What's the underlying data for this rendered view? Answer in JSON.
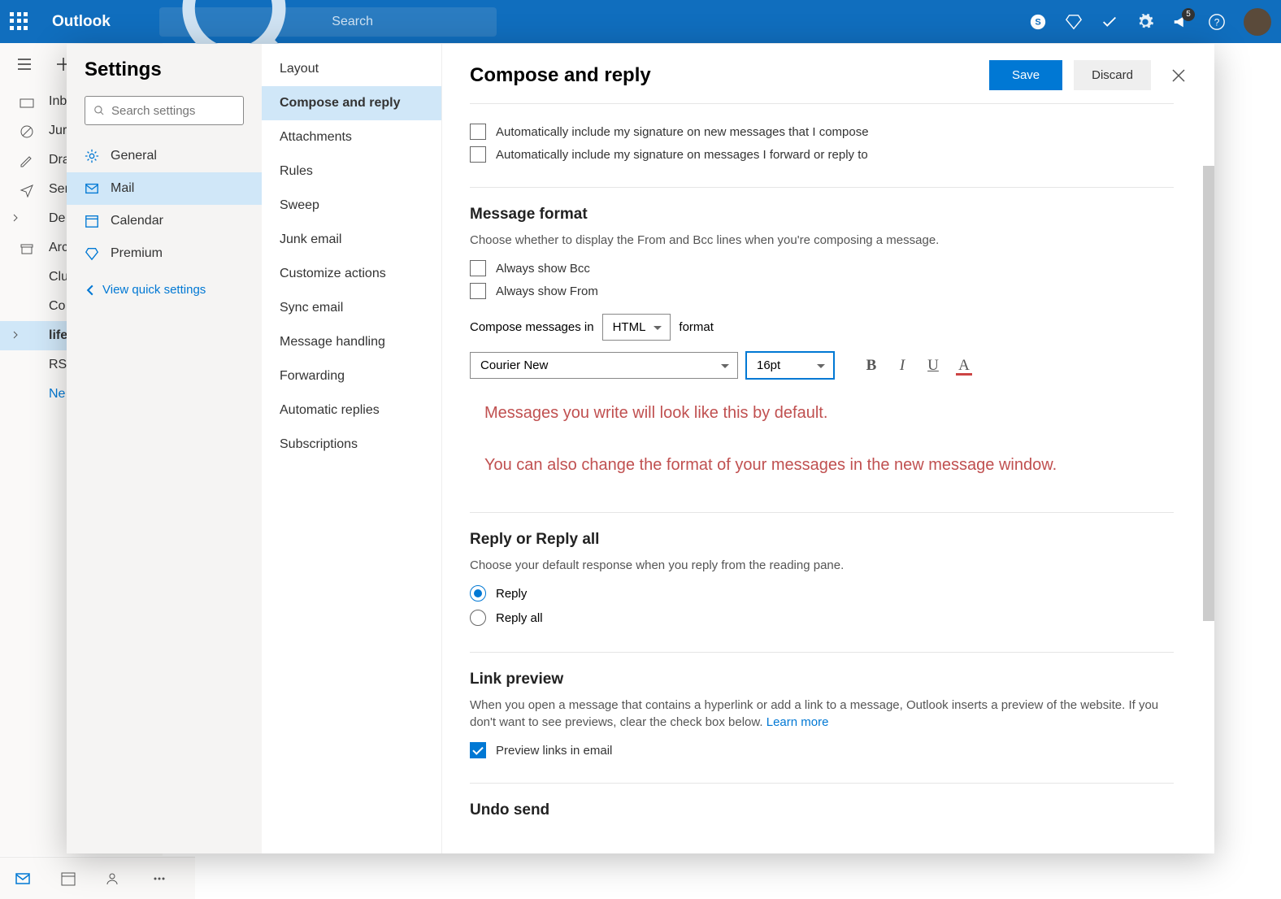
{
  "header": {
    "brand": "Outlook",
    "search_placeholder": "Search",
    "notification_count": "5"
  },
  "folders": [
    {
      "label": "Inb"
    },
    {
      "label": "Jur"
    },
    {
      "label": "Dra"
    },
    {
      "label": "Ser"
    },
    {
      "label": "De"
    },
    {
      "label": "Arc"
    },
    {
      "label": "Clu"
    },
    {
      "label": "Co"
    },
    {
      "label": "life",
      "active": true
    },
    {
      "label": "RSS"
    },
    {
      "label": "Ne",
      "new": true
    }
  ],
  "settings": {
    "title": "Settings",
    "search_placeholder": "Search settings",
    "categories": [
      {
        "label": "General",
        "key": "general"
      },
      {
        "label": "Mail",
        "key": "mail",
        "active": true
      },
      {
        "label": "Calendar",
        "key": "calendar"
      },
      {
        "label": "Premium",
        "key": "premium"
      }
    ],
    "quick_link": "View quick settings",
    "subitems": [
      "Layout",
      "Compose and reply",
      "Attachments",
      "Rules",
      "Sweep",
      "Junk email",
      "Customize actions",
      "Sync email",
      "Message handling",
      "Forwarding",
      "Automatic replies",
      "Subscriptions"
    ],
    "active_sub": "Compose and reply",
    "panel": {
      "title": "Compose and reply",
      "save": "Save",
      "discard": "Discard",
      "sig_new": "Automatically include my signature on new messages that I compose",
      "sig_fwd": "Automatically include my signature on messages I forward or reply to",
      "msgformat_title": "Message format",
      "msgformat_desc": "Choose whether to display the From and Bcc lines when you're composing a message.",
      "show_bcc": "Always show Bcc",
      "show_from": "Always show From",
      "compose_in_pre": "Compose messages in",
      "compose_format": "HTML",
      "compose_in_post": "format",
      "font_family": "Courier New",
      "font_size": "16pt",
      "preview_line1": "Messages you write will look like this by default.",
      "preview_line2": "You can also change the format of your messages in the new message window.",
      "reply_title": "Reply or Reply all",
      "reply_desc": "Choose your default response when you reply from the reading pane.",
      "reply_opt1": "Reply",
      "reply_opt2": "Reply all",
      "link_title": "Link preview",
      "link_desc": "When you open a message that contains a hyperlink or add a link to a message, Outlook inserts a preview of the website. If you don't want to see previews, clear the check box below. ",
      "learn_more": "Learn more",
      "link_check": "Preview links in email",
      "undo_title": "Undo send"
    }
  }
}
